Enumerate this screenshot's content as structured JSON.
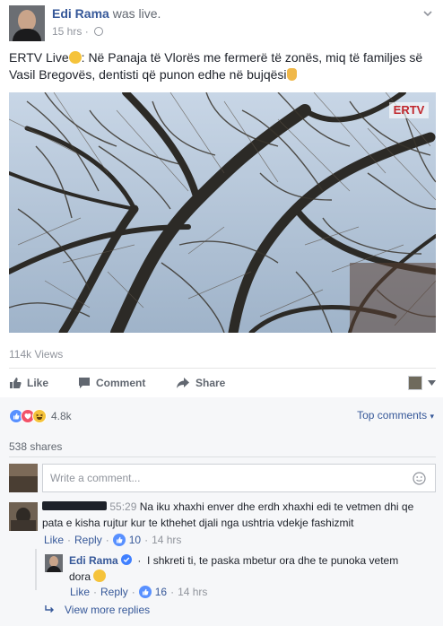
{
  "post": {
    "author": "Edi Rama",
    "action": "was live.",
    "time": "15 hrs",
    "text": "ERTV Live",
    "text_rest": ": Në Panaja të Vlorës me fermerë të zonës, miq të familjes së Vasil Bregovës, dentisti që punon edhe në bujqësi",
    "video_watermark": "ERTV",
    "views": "114k Views"
  },
  "actions": {
    "like": "Like",
    "comment": "Comment",
    "share": "Share"
  },
  "reactions": {
    "count": "4.8k",
    "sort_label": "Top comments",
    "shares": "538 shares",
    "colors": {
      "like": "#5890ff",
      "love": "#f25268",
      "haha": "#f5c33b"
    }
  },
  "composer": {
    "placeholder": "Write a comment..."
  },
  "comments": [
    {
      "author": "",
      "timestamp": "55:29",
      "text": "Na iku xhaxhi enver dhe erdh xhaxhi edi te vetmen dhi qe pata e kisha rujtur kur te kthehet djali nga ushtria vdekje fashizmit",
      "like_label": "Like",
      "reply_label": "Reply",
      "likes": "10",
      "age": "14 hrs"
    }
  ],
  "reply": {
    "author": "Edi Rama",
    "text": "I shkreti ti, te paska mbetur ora dhe te punoka vetem dora",
    "like_label": "Like",
    "reply_label": "Reply",
    "likes": "16",
    "age": "14 hrs"
  },
  "view_more": "View more replies"
}
